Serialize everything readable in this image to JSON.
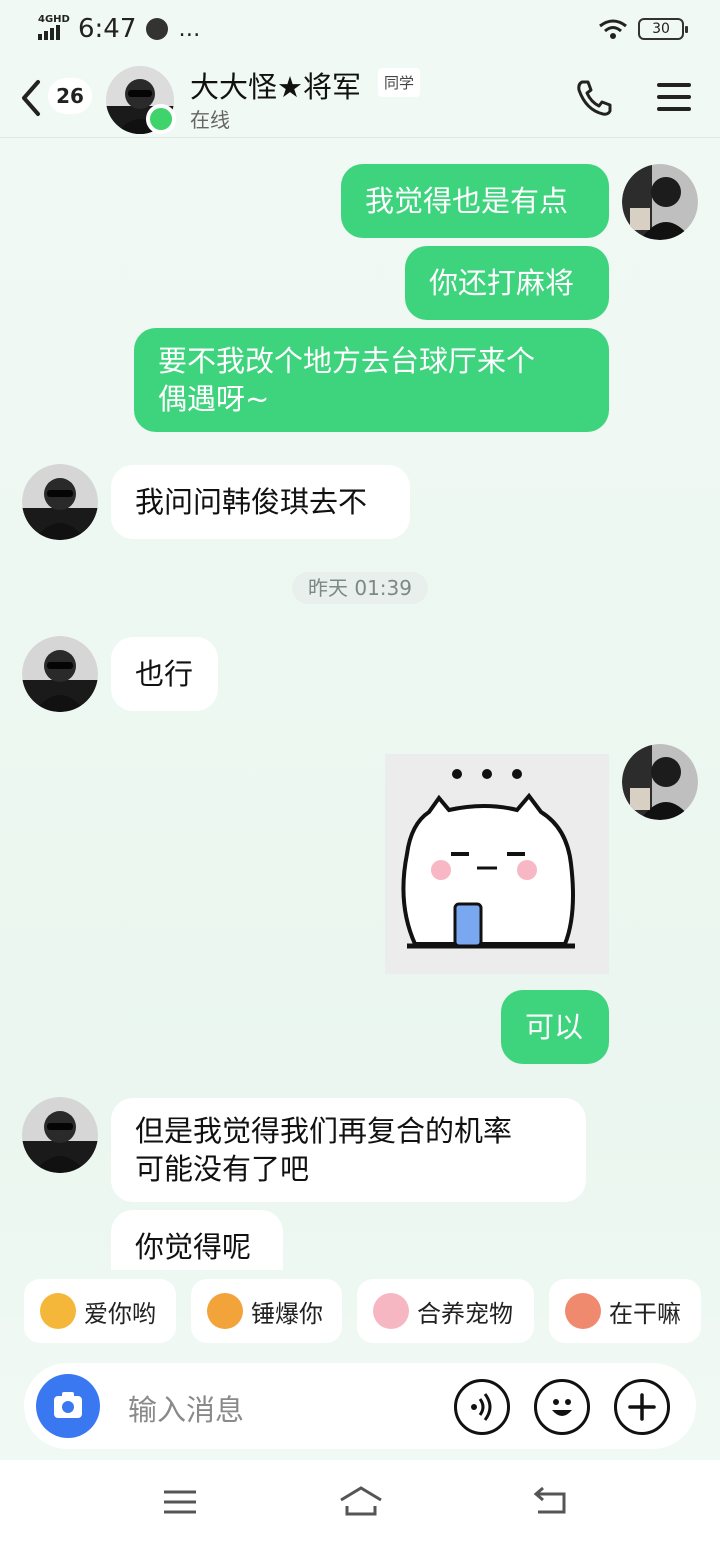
{
  "status_bar": {
    "network": "4GHD",
    "time": "6:47",
    "more": "…",
    "battery": "30"
  },
  "header": {
    "unread_count": "26",
    "contact_name": "大大怪★将军",
    "tag": "同学",
    "status": "在线"
  },
  "messages": {
    "m1": "我觉得也是有点",
    "m2": "你还打麻将",
    "m3_line1": "要不我改个地方去台球厅来个",
    "m3_line2": "偶遇呀~",
    "m4": "我问问韩俊琪去不",
    "timestamp": "昨天 01:39",
    "m5": "也行",
    "m6": "可以",
    "m7_line1": "但是我觉得我们再复合的机率",
    "m7_line2": "可能没有了吧",
    "m8": "你觉得呢"
  },
  "quick_replies": [
    {
      "label": "爱你哟"
    },
    {
      "label": "锤爆你"
    },
    {
      "label": "合养宠物"
    },
    {
      "label": "在干嘛"
    }
  ],
  "input": {
    "placeholder": "输入消息"
  },
  "colors": {
    "outgoing_bubble": "#3ed37d",
    "incoming_bubble": "#ffffff",
    "online": "#3ed36b",
    "camera_button": "#3a78f2"
  },
  "icons": [
    "back-icon",
    "phone-icon",
    "menu-icon",
    "camera-icon",
    "voice-icon",
    "emoji-icon",
    "plus-icon",
    "nav-menu-icon",
    "nav-home-icon",
    "nav-back-icon"
  ]
}
